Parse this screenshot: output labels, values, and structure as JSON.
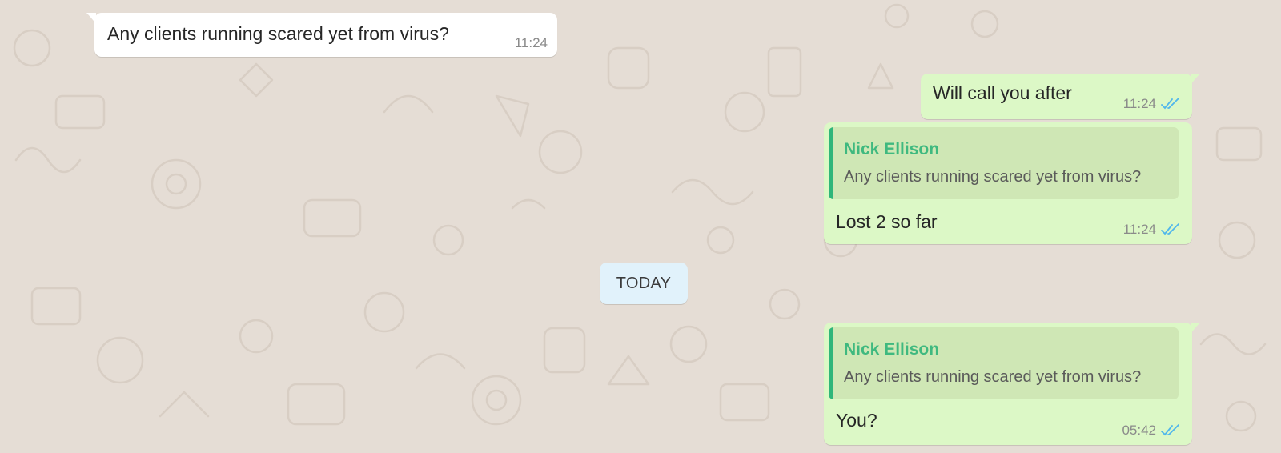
{
  "conversation": {
    "messages": [
      {
        "direction": "incoming",
        "text": "Any clients running scared yet from virus?",
        "time": "11:24"
      },
      {
        "direction": "outgoing",
        "text": "Will call you after",
        "time": "11:24",
        "status": "read"
      },
      {
        "direction": "outgoing",
        "reply_to": {
          "author": "Nick Ellison",
          "text": "Any clients running scared yet from virus?"
        },
        "text": "Lost 2 so far",
        "time": "11:24",
        "status": "read"
      },
      {
        "direction": "outgoing",
        "reply_to": {
          "author": "Nick Ellison",
          "text": "Any clients running scared yet from virus?"
        },
        "text": "You?",
        "time": "05:42",
        "status": "read"
      }
    ],
    "date_divider": "TODAY"
  },
  "icons": {
    "read_receipt": "double-check-icon"
  },
  "colors": {
    "wallpaper": "#e5ddd5",
    "incoming_bubble": "#ffffff",
    "outgoing_bubble": "#dcf8c6",
    "quote_accent": "#2fb67a",
    "read_tick": "#4fb6ec",
    "date_chip": "#e1f2fb"
  }
}
